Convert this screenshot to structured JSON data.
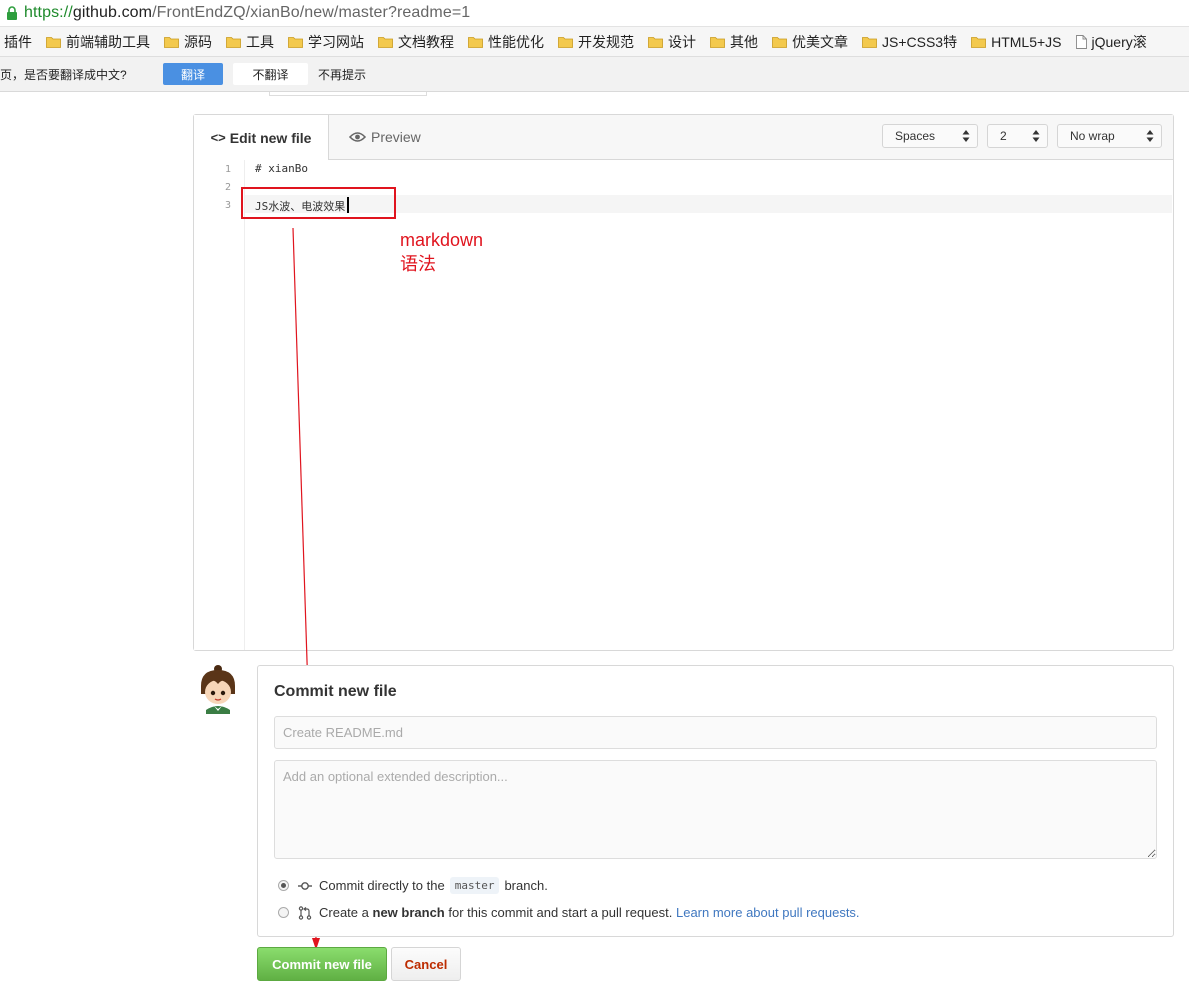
{
  "browser": {
    "url_scheme": "https://",
    "url_host": "github.com",
    "url_path": "/FrontEndZQ/xianBo/new/master?readme=1"
  },
  "bookmarks": [
    {
      "label": "插件",
      "type": "none"
    },
    {
      "label": "前端辅助工具",
      "type": "folder"
    },
    {
      "label": "源码",
      "type": "folder"
    },
    {
      "label": "工具",
      "type": "folder"
    },
    {
      "label": "学习网站",
      "type": "folder"
    },
    {
      "label": "文档教程",
      "type": "folder"
    },
    {
      "label": "性能优化",
      "type": "folder"
    },
    {
      "label": "开发规范",
      "type": "folder"
    },
    {
      "label": "设计",
      "type": "folder"
    },
    {
      "label": "其他",
      "type": "folder"
    },
    {
      "label": "优美文章",
      "type": "folder"
    },
    {
      "label": "JS+CSS3特",
      "type": "folder"
    },
    {
      "label": "HTML5+JS",
      "type": "folder"
    },
    {
      "label": "jQuery滚",
      "type": "page"
    }
  ],
  "translate_bar": {
    "message": "页，是否要翻译成中文?",
    "translate_button": "翻译",
    "no_translate_button": "不翻译",
    "never_label": "不再提示"
  },
  "editor": {
    "tab_edit": "Edit new file",
    "tab_preview": "Preview",
    "indent_mode": "Spaces",
    "indent_size": "2",
    "wrap_mode": "No wrap",
    "lines": [
      {
        "no": "1",
        "text": "# xianBo"
      },
      {
        "no": "2",
        "text": ""
      },
      {
        "no": "3",
        "text": "JS水波、电波效果"
      }
    ]
  },
  "annotation": {
    "line1": "markdown",
    "line2": "语法",
    "color": "#e0141e"
  },
  "commit": {
    "title": "Commit new file",
    "summary_placeholder": "Create README.md",
    "description_placeholder": "Add an optional extended description...",
    "option_direct_prefix": "Commit directly to the",
    "branch_name": "master",
    "option_direct_suffix": "branch.",
    "option_new_prefix": "Create a",
    "option_new_bold": "new branch",
    "option_new_suffix": "for this commit and start a pull request.",
    "learn_more": "Learn more about pull requests.",
    "commit_button": "Commit new file",
    "cancel_button": "Cancel"
  },
  "colors": {
    "commit_green": "#60b044",
    "cancel_red": "#bd2c00",
    "link_blue": "#4078c0",
    "translate_blue": "#4a90e2"
  }
}
